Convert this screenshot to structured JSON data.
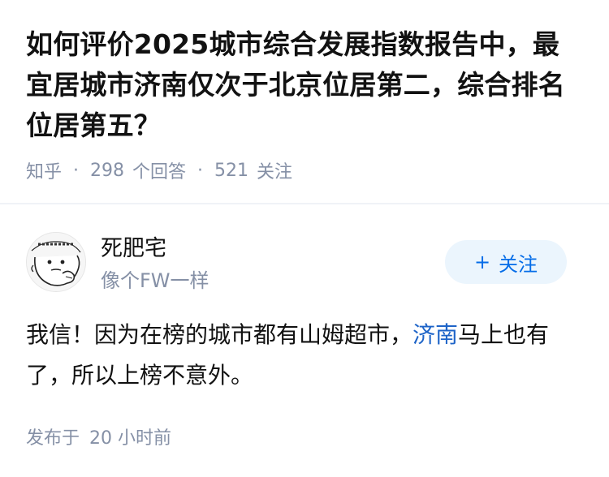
{
  "question": {
    "title": "如何评价2025城市综合发展指数报告中，最宜居城市济南仅次于北京位居第二，综合排名位居第五？",
    "source": "知乎",
    "answers_count": "298",
    "answers_label": "个回答",
    "followers_count": "521",
    "followers_label": "关注"
  },
  "author": {
    "name": "死肥宅",
    "bio": "像个FW一样",
    "avatar_icon": "cartoon-face-avatar",
    "follow_label": "关注",
    "follow_color": "#056de8"
  },
  "answer": {
    "text_before": "我信！因为在榜的城市都有山姆超市，",
    "link_text": "济南",
    "text_after": "马上也有了，所以上榜不意外。",
    "link_color": "#1e64c8"
  },
  "meta": {
    "posted_label": "发布于",
    "posted_time": "20 小时前"
  }
}
